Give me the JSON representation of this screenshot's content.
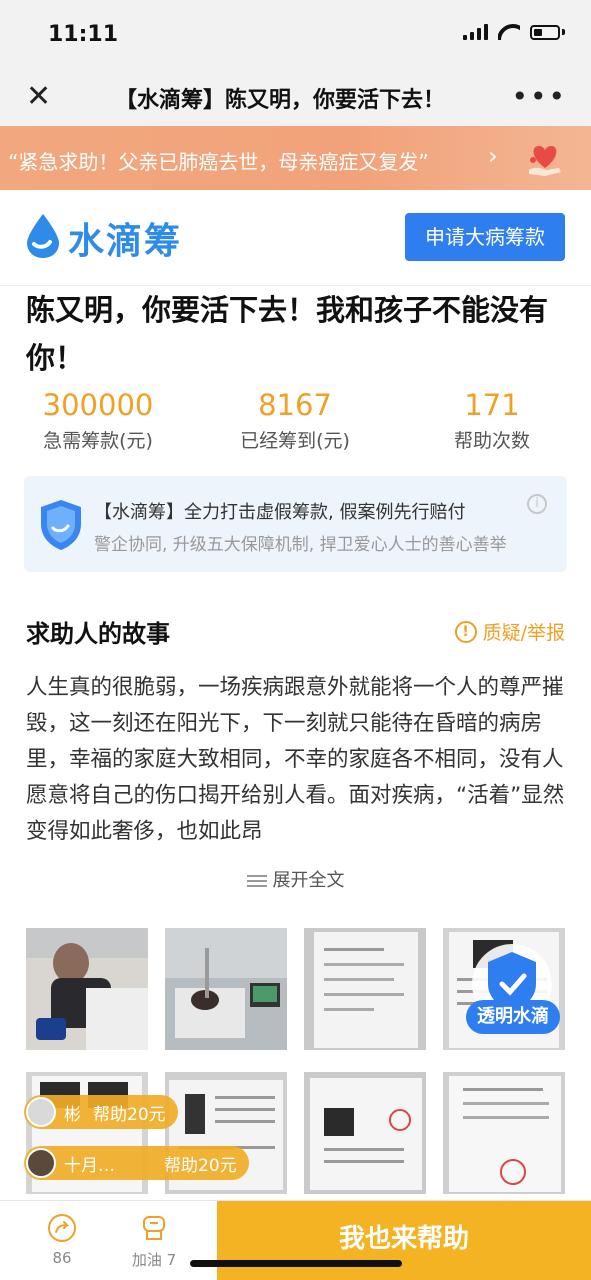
{
  "status_bar": {
    "time": "11:11"
  },
  "nav": {
    "title": "【水滴筹】陈又明，你要活下去！"
  },
  "banner": {
    "text": "“紧急求助！父亲已肺癌去世，母亲癌症又复发”"
  },
  "brand": {
    "logo_text": "水滴筹",
    "apply_label": "申请大病筹款"
  },
  "campaign": {
    "title": "陈又明，你要活下去！我和孩子不能没有你！",
    "stats": [
      {
        "value": "300000",
        "label": "急需筹款(元)"
      },
      {
        "value": "8167",
        "label": "已经筹到(元)"
      },
      {
        "value": "171",
        "label": "帮助次数"
      }
    ]
  },
  "notice": {
    "title": "【水滴筹】全力打击虚假筹款, 假案例先行赔付",
    "subtitle": "警企协同, 升级五大保障机制, 捍卫爱心人士的善心善举"
  },
  "story": {
    "heading": "求助人的故事",
    "report_label": "质疑/举报",
    "text": "人生真的很脆弱，一场疾病跟意外就能将一个人的尊严摧毁，这一刻还在阳光下，下一刻就只能待在昏暗的病房里，幸福的家庭大致相同，不幸的家庭各不相同，没有人愿意将自己的伤口揭开给别人看。面对疾病，“活着”显然变得如此奢侈，也如此昂",
    "expand_label": "展开全文"
  },
  "float_badge": {
    "label": "透明水滴"
  },
  "donors": [
    {
      "name": "彬",
      "action": "帮助20元"
    },
    {
      "name": "十月…",
      "action": "帮助20元"
    }
  ],
  "bottom_bar": {
    "share_count": "86",
    "cheer_label": "加油 7",
    "help_label": "我也来帮助"
  },
  "colors": {
    "brand_blue": "#2f7ef0",
    "accent_orange": "#f0a025",
    "help_yellow": "#f4b322",
    "banner": "#f2a27a"
  }
}
